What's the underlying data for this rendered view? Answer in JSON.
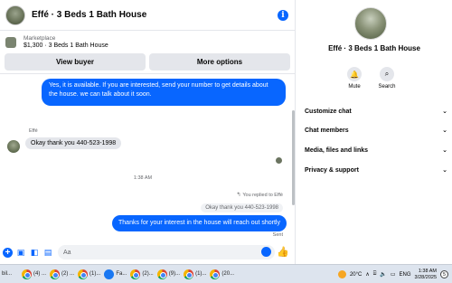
{
  "header": {
    "title": "Effé · 3 Beds 1 Bath House",
    "info_icon": "i"
  },
  "listing": {
    "category": "Marketplace",
    "name": "$1,300 · 3 Beds 1 Bath House"
  },
  "buttons": {
    "view_buyer": "View buyer",
    "more_options": "More options"
  },
  "messages": {
    "outgoing_1": "Yes, it is available. If you are interested, send your number to get details about the house. we can talk about it soon.",
    "sender_name": "Effé",
    "incoming_1": "Okay thank you 440-523-1998",
    "timestamp": "1:38 AM",
    "replied_label": "You replied to Effé",
    "quoted_text": "Okay thank you 440-523-1998",
    "outgoing_2": "Thanks for your interest in the house will reach out shortly",
    "status": "Sent"
  },
  "composer": {
    "placeholder": "Aa"
  },
  "info_panel": {
    "name": "Effé · 3 Beds 1 Bath House",
    "actions": [
      {
        "label": "Mute",
        "icon": "bell-icon"
      },
      {
        "label": "Search",
        "icon": "search-icon"
      }
    ],
    "sections": [
      "Customize chat",
      "Chat members",
      "Media, files and links",
      "Privacy & support"
    ]
  },
  "taskbar": {
    "first_label": "bil...",
    "items": [
      {
        "label": "(4) ...",
        "icon": "chrome-icon"
      },
      {
        "label": "(2) ...",
        "icon": "chrome-icon"
      },
      {
        "label": "(1)...",
        "icon": "chrome-icon"
      },
      {
        "label": "Fa...",
        "icon": "facebook-icon"
      },
      {
        "label": "(2)...",
        "icon": "chrome-icon"
      },
      {
        "label": "(9)...",
        "icon": "chrome-icon"
      },
      {
        "label": "(1)...",
        "icon": "chrome-icon"
      },
      {
        "label": "(20...",
        "icon": "chrome-icon"
      }
    ],
    "temperature": "20°C",
    "language": "ENG",
    "time": "1:38 AM",
    "date": "3/28/2025",
    "notification_count": "5"
  },
  "colors": {
    "accent": "#0866ff",
    "bubble_in": "#e4e6eb",
    "taskbar": "#dde4ee"
  }
}
